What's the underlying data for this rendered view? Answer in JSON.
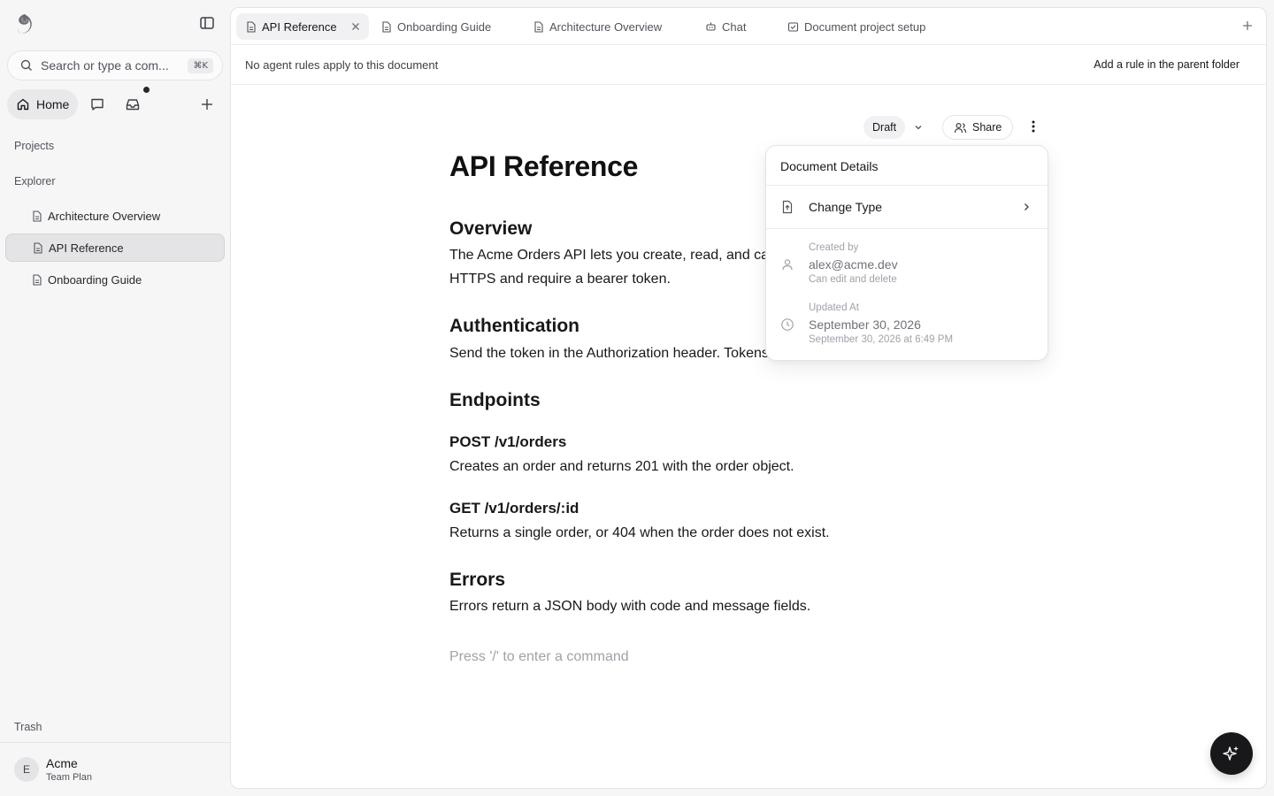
{
  "sidebar": {
    "search_placeholder": "Search or type a com...",
    "search_shortcut": "⌘K",
    "home_label": "Home",
    "projects_label": "Projects",
    "explorer_label": "Explorer",
    "items": [
      {
        "label": "Architecture Overview",
        "active": false
      },
      {
        "label": "API Reference",
        "active": true
      },
      {
        "label": "Onboarding Guide",
        "active": false
      }
    ],
    "trash_label": "Trash",
    "org": {
      "initial": "E",
      "name": "Acme",
      "plan": "Team Plan"
    }
  },
  "tabs": [
    {
      "label": "API Reference",
      "icon": "document-icon",
      "active": true
    },
    {
      "label": "Onboarding Guide",
      "icon": "document-icon",
      "active": false
    },
    {
      "label": "Architecture Overview",
      "icon": "document-icon",
      "active": false
    },
    {
      "label": "Chat",
      "icon": "bot-icon",
      "active": false
    },
    {
      "label": "Document project setup",
      "icon": "task-icon",
      "active": false
    }
  ],
  "rulebar": {
    "message": "No agent rules apply to this document",
    "link": "Add a rule in the parent folder"
  },
  "toolbar": {
    "status": "Draft",
    "share_label": "Share"
  },
  "document": {
    "title": "API Reference",
    "overview_heading": "Overview",
    "overview_text": "The Acme Orders API lets you create, read, and ca",
    "overview_text_2": "HTTPS and require a bearer token.",
    "auth_heading": "Authentication",
    "auth_text": "Send the token in the Authorization header. Tokens",
    "endpoints_heading": "Endpoints",
    "post_heading": "POST /v1/orders",
    "post_text": "Creates an order and returns 201 with the order object.",
    "get_heading": "GET /v1/orders/:id",
    "get_text": "Returns a single order, or 404 when the order does not exist.",
    "errors_heading": "Errors",
    "errors_text": "Errors return a JSON body with code and message fields.",
    "command_placeholder": "Press '/' to enter a command"
  },
  "popover": {
    "title": "Document Details",
    "change_type_label": "Change Type",
    "created_label": "Created by",
    "created_value": "alex@acme.dev",
    "created_sub": "Can edit and delete",
    "updated_label": "Updated At",
    "updated_value": "September 30, 2026",
    "updated_sub": "September 30, 2026 at 6:49 PM"
  },
  "colors": {
    "accent_dark": "#18181b",
    "sidebar_bg": "#f6f6f7",
    "muted_text": "#a1a1aa"
  }
}
